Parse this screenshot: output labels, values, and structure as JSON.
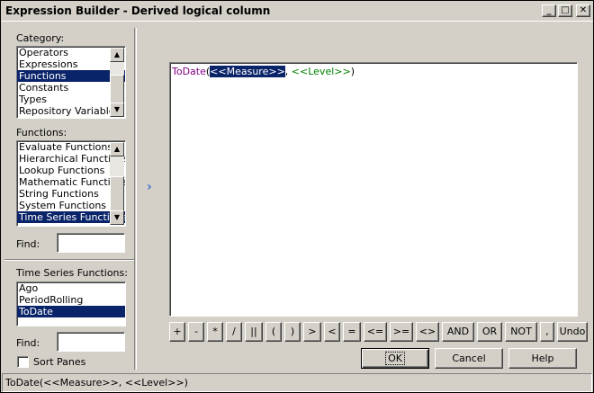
{
  "window": {
    "title": "Expression Builder - Derived logical column",
    "minimize_glyph": "_",
    "maximize_glyph": "□",
    "close_glyph": "✕"
  },
  "category": {
    "label": "Category:",
    "items": [
      "Operators",
      "Expressions",
      "Functions",
      "Constants",
      "Types",
      "Repository Variables"
    ],
    "selected_index": 2
  },
  "functions": {
    "label": "Functions:",
    "items": [
      "Evaluate Functions",
      "Hierarchical Functions",
      "Lookup Functions",
      "Mathematic Functions",
      "String Functions",
      "System Functions",
      "Time Series Functions"
    ],
    "selected_index": 6
  },
  "find1": {
    "label": "Find:",
    "value": ""
  },
  "time_series": {
    "label": "Time Series Functions:",
    "items": [
      "Ago",
      "PeriodRolling",
      "ToDate"
    ],
    "selected_index": 2
  },
  "find2": {
    "label": "Find:",
    "value": ""
  },
  "sort_panes": {
    "label": "Sort Panes",
    "checked": false
  },
  "insert_arrow_glyph": "›",
  "expression": {
    "fn": "ToDate",
    "open": "(",
    "measure": "<<Measure>>",
    "sep": ", ",
    "level": "<<Level>>",
    "close": ")"
  },
  "operators": [
    "+",
    "-",
    "*",
    "/",
    "||",
    "(",
    ")",
    ">",
    "<",
    "=",
    "<=",
    ">=",
    "<>",
    "AND",
    "OR",
    "NOT",
    ",",
    "Undo"
  ],
  "buttons": {
    "ok": "OK",
    "cancel": "Cancel",
    "help": "Help"
  },
  "status": "ToDate(<<Measure>>, <<Level>>)",
  "colors": {
    "selection": "#0a246a",
    "function": "#800080",
    "placeholder": "#008000",
    "arrow": "#3a6fc4"
  }
}
